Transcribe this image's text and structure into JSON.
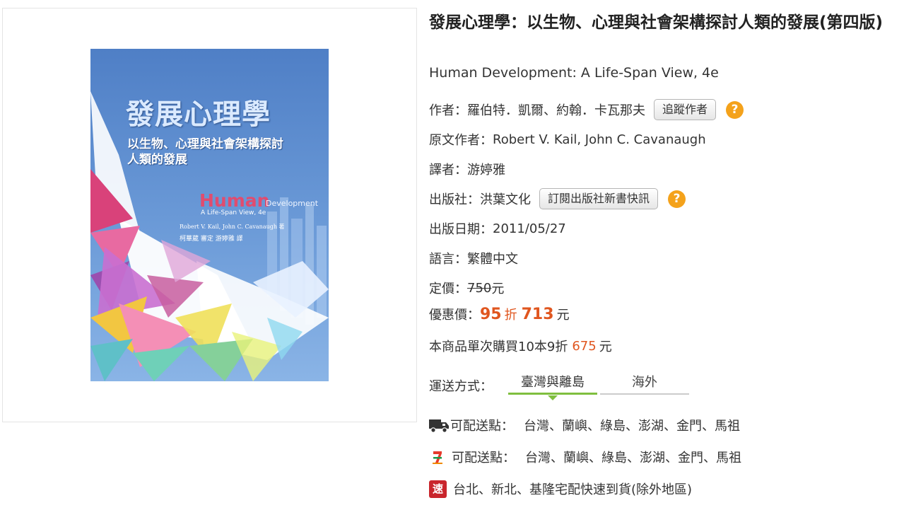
{
  "cover": {
    "title_zh": "發展心理學",
    "subtitle_zh": "以生物、心理與社會架構探討人類的發展",
    "title_en_bold": "Human",
    "title_en_light": "Development",
    "edition_en": "A Life-Span View, 4e",
    "authors_en": "Robert V. Kail, John C. Cavanaugh 著",
    "translators_zh": "柯華葳 審定   游婷雅 譯"
  },
  "book": {
    "title": "發展心理學：以生物、心理與社會架構探討人類的發展(第四版)",
    "subtitle": "Human Development: A Life-Span View, 4e"
  },
  "author": {
    "label": "作者：",
    "value": "羅伯特．凱爾、約翰．卡瓦那夫",
    "button": "追蹤作者"
  },
  "original_author": {
    "label": "原文作者：",
    "value": "Robert V. Kail, John C. Cavanaugh"
  },
  "translator": {
    "label": "譯者：",
    "value": "游婷雅"
  },
  "publisher": {
    "label": "出版社：",
    "value": "洪葉文化",
    "button": "訂閱出版社新書快訊"
  },
  "pub_date": {
    "label": "出版日期：",
    "value": "2011/05/27"
  },
  "language": {
    "label": "語言：",
    "value": "繁體中文"
  },
  "list_price": {
    "label": "定價：",
    "value": "750",
    "unit": "元"
  },
  "sale_price": {
    "label": "優惠價：",
    "discount": "95",
    "discount_unit": "折",
    "price": "713",
    "unit": "元"
  },
  "bulk": {
    "text": "本商品單次購買10本9折",
    "price": "675",
    "unit": "元"
  },
  "shipping": {
    "label": "運送方式：",
    "tabs": [
      "臺灣與離島",
      "海外"
    ],
    "active_tab": 0,
    "home_label": "可配送點：",
    "home_places": "台灣、蘭嶼、綠島、澎湖、金門、馬祖",
    "store_label": "可配送點：",
    "store_places": "台灣、蘭嶼、綠島、澎湖、金門、馬祖",
    "express_badge": "速",
    "express_text": "台北、新北、基隆宅配快速到貨(除外地區)"
  },
  "help_icon_text": "?",
  "colors": {
    "accent_orange": "#e0561f",
    "help_yellow": "#f4a21b",
    "tab_green": "#7fbf3f",
    "express_red": "#c9252c"
  }
}
